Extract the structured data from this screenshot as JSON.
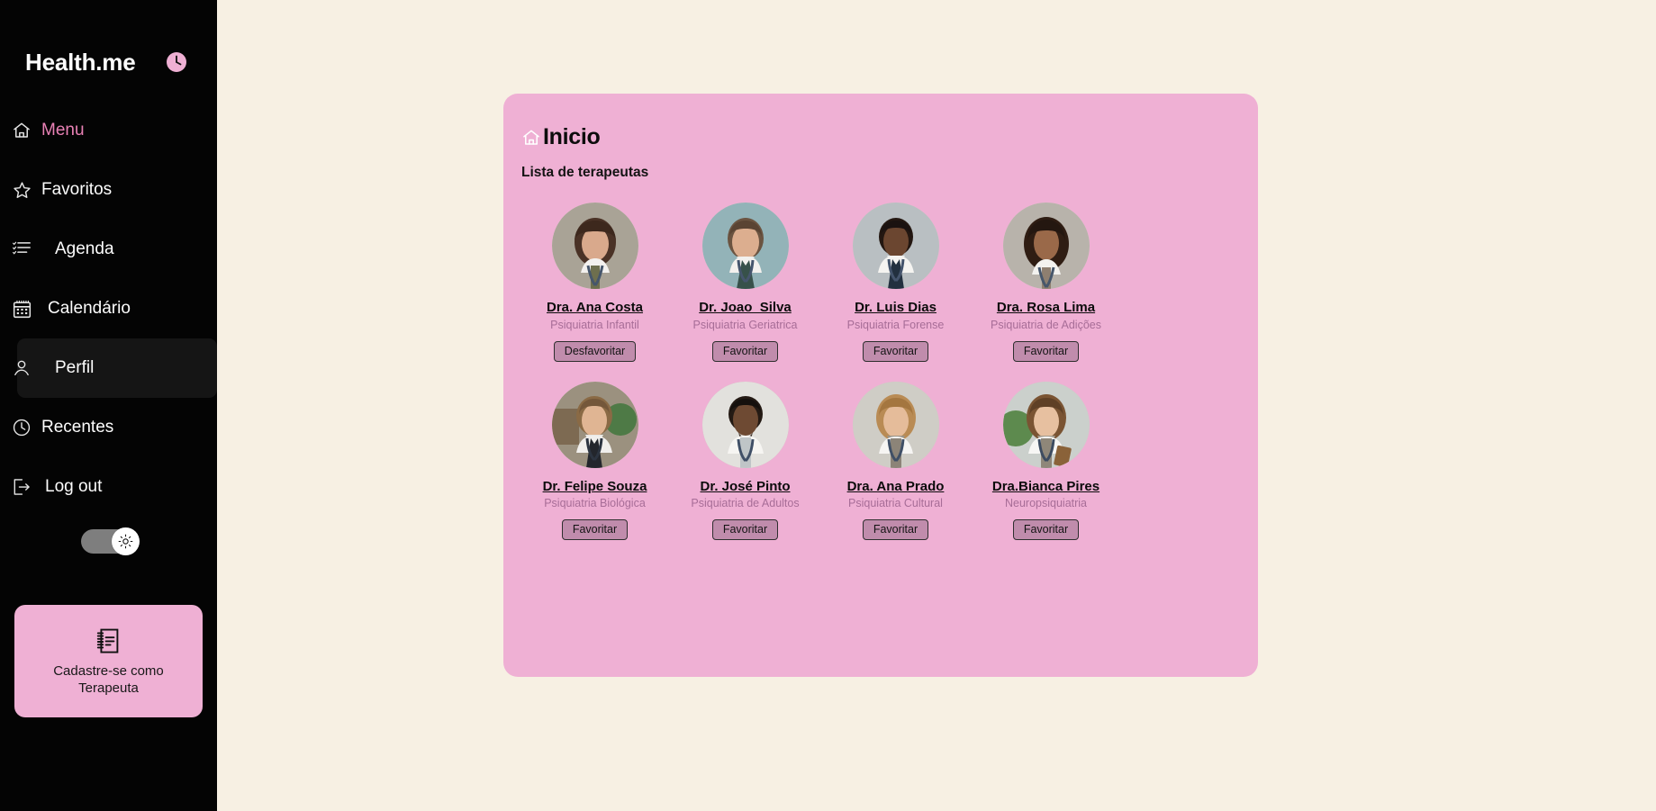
{
  "sidebar": {
    "brand": {
      "title": "Health.me",
      "icon": "clock-icon"
    },
    "items": [
      {
        "label": "Menu",
        "icon": "home-icon",
        "active": true
      },
      {
        "label": "Favoritos",
        "icon": "star-icon",
        "active": false
      },
      {
        "label": "Agenda",
        "icon": "list-icon",
        "active": false
      },
      {
        "label": "Calendário",
        "icon": "calendar-icon",
        "active": false
      },
      {
        "label": "Perfil",
        "icon": "user-icon",
        "active": false
      },
      {
        "label": "Recentes",
        "icon": "clock-icon",
        "active": false
      },
      {
        "label": "Log out",
        "icon": "logout-icon",
        "active": false
      }
    ],
    "theme_toggle": {
      "state": "light",
      "icon": "sun-icon"
    },
    "register_card": {
      "label": "Cadastre-se como Terapeuta",
      "icon": "notebook-icon"
    }
  },
  "panel": {
    "title": "Inicio",
    "title_icon": "home-icon",
    "subtitle": "Lista de terapeutas",
    "therapists": [
      {
        "name": "Dra. Ana Costa",
        "specialty": "Psiquiatria Infantil",
        "button": "Desfavoritar",
        "favorited": true
      },
      {
        "name": "Dr. Joao_Silva",
        "specialty": "Psiquiatria Geriatrica",
        "button": "Favoritar",
        "favorited": false
      },
      {
        "name": "Dr. Luis Dias",
        "specialty": "Psiquiatria Forense",
        "button": "Favoritar",
        "favorited": false
      },
      {
        "name": "Dra. Rosa Lima",
        "specialty": "Psiquiatria de Adições",
        "button": "Favoritar",
        "favorited": false
      },
      {
        "name": "Dr. Felipe Souza",
        "specialty": "Psiquiatria Biológica",
        "button": "Favoritar",
        "favorited": false
      },
      {
        "name": "Dr. José Pinto",
        "specialty": "Psiquiatria de Adultos",
        "button": "Favoritar",
        "favorited": false
      },
      {
        "name": "Dra. Ana Prado",
        "specialty": "Psiquiatria Cultural",
        "button": "Favoritar",
        "favorited": false
      },
      {
        "name": "Dra.Bianca Pires",
        "specialty": "Neuropsiquiatria",
        "button": "Favoritar",
        "favorited": false
      }
    ]
  },
  "colors": {
    "page_background": "#f7f0e3",
    "sidebar_background": "#040404",
    "panel_background": "#efb0d4",
    "accent_pink": "#e981b5",
    "specialty_text": "#a76d97",
    "button_background": "#c08cac"
  }
}
